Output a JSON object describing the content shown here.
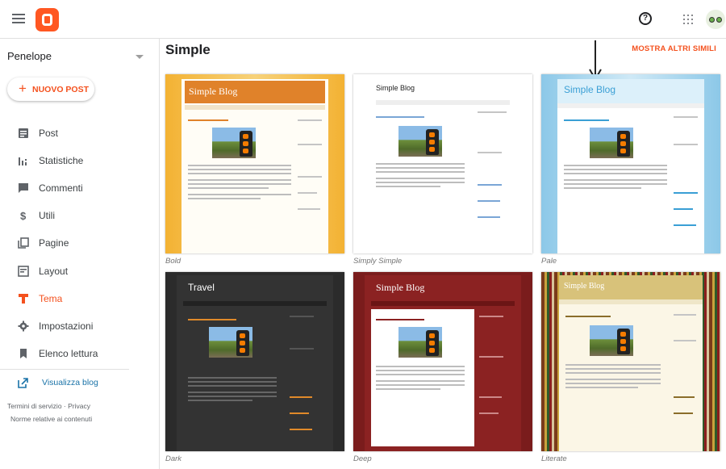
{
  "app": {
    "name": "Blogger",
    "colors": {
      "accent": "#f4511e",
      "link": "#1a73a8",
      "brand": "#ff5722"
    }
  },
  "header": {
    "menu_icon": "hamburger-menu-icon",
    "help_icon": "help-circle-icon",
    "apps_icon": "apps-grid-icon"
  },
  "sidebar": {
    "blog_name": "Penelope",
    "new_post_label": "NUOVO POST",
    "items": [
      {
        "label": "Post",
        "icon": "post-icon",
        "active": false
      },
      {
        "label": "Statistiche",
        "icon": "stats-icon",
        "active": false
      },
      {
        "label": "Commenti",
        "icon": "comment-icon",
        "active": false
      },
      {
        "label": "Utili",
        "icon": "dollar-icon",
        "active": false
      },
      {
        "label": "Pagine",
        "icon": "pages-icon",
        "active": false
      },
      {
        "label": "Layout",
        "icon": "layout-icon",
        "active": false
      },
      {
        "label": "Tema",
        "icon": "brush-icon",
        "active": true
      },
      {
        "label": "Impostazioni",
        "icon": "gear-icon",
        "active": false
      },
      {
        "label": "Elenco lettura",
        "icon": "bookmark-icon",
        "active": false
      }
    ],
    "view_blog_label": "Visualizza blog",
    "footer": {
      "terms": "Termini di servizio",
      "sep": "·",
      "privacy": "Privacy",
      "policy": "Norme relative ai contenuti"
    }
  },
  "main": {
    "title": "Simple",
    "more_label": "MOSTRA ALTRI SIMILI",
    "themes": [
      {
        "name": "Bold",
        "preview_title": "Simple Blog"
      },
      {
        "name": "Simply Simple",
        "preview_title": "Simple Blog"
      },
      {
        "name": "Pale",
        "preview_title": "Simple Blog"
      },
      {
        "name": "Dark",
        "preview_title": "Travel"
      },
      {
        "name": "Deep",
        "preview_title": "Simple Blog"
      },
      {
        "name": "Literate",
        "preview_title": "Simple Blog"
      }
    ]
  }
}
